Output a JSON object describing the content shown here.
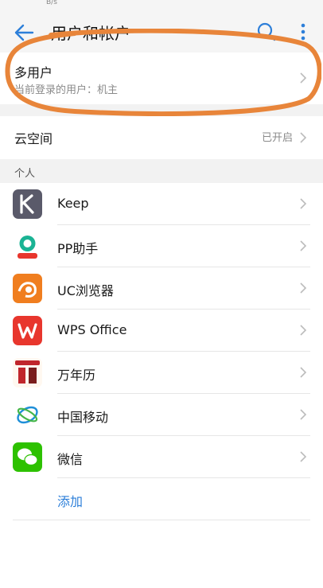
{
  "status_bar": {
    "fragment": "B/s"
  },
  "header": {
    "title": "用户和帐户"
  },
  "multi_user": {
    "title": "多用户",
    "subtitle": "当前登录的用户：机主"
  },
  "cloud": {
    "title": "云空间",
    "status": "已开启"
  },
  "section": {
    "title": "个人"
  },
  "apps": [
    {
      "name": "Keep",
      "icon": "keep-icon",
      "color": "#5a5a6a"
    },
    {
      "name": "PP助手",
      "icon": "pp-assistant-icon",
      "color": "#1ab394"
    },
    {
      "name": "UC浏览器",
      "icon": "uc-browser-icon",
      "color": "#f07e1f"
    },
    {
      "name": "WPS Office",
      "icon": "wps-office-icon",
      "color": "#e8362d"
    },
    {
      "name": "万年历",
      "icon": "calendar-icon",
      "color": "#c0262c"
    },
    {
      "name": "中国移动",
      "icon": "china-mobile-icon",
      "color": "#1f8fd8"
    },
    {
      "name": "微信",
      "icon": "wechat-icon",
      "color": "#2dc100"
    }
  ],
  "add": {
    "label": "添加"
  },
  "accent": "#2d7fd9",
  "annotation_color": "#e8853a"
}
